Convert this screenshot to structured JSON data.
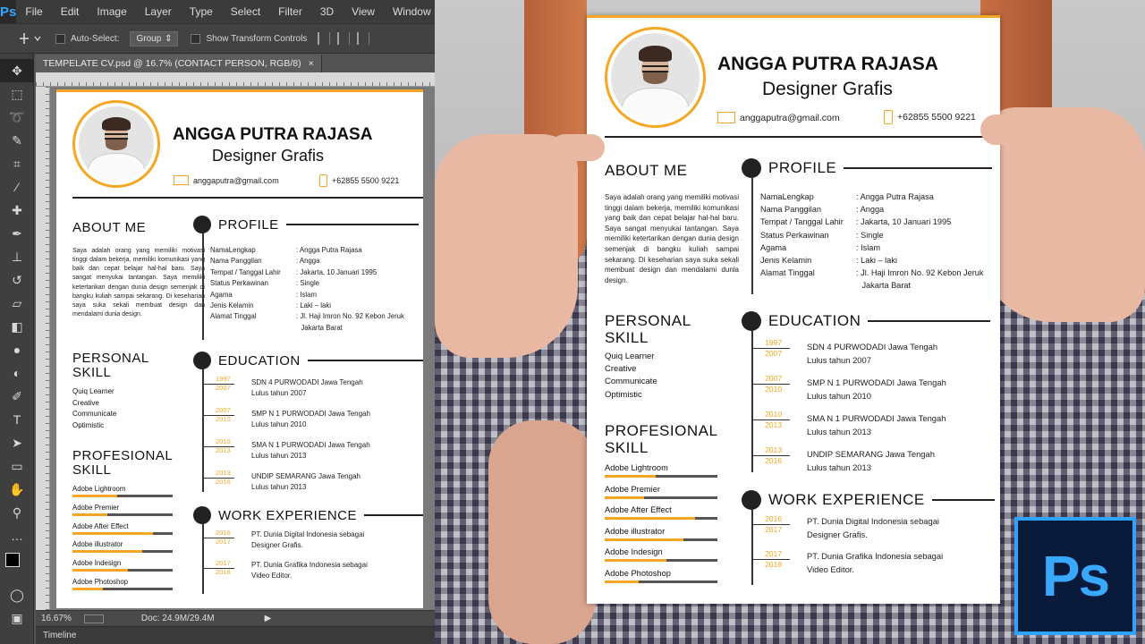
{
  "photoshop": {
    "logo": "Ps",
    "menu": [
      "File",
      "Edit",
      "Image",
      "Layer",
      "Type",
      "Select",
      "Filter",
      "3D",
      "View",
      "Window"
    ],
    "options": {
      "auto_select_label": "Auto-Select:",
      "group_value": "Group",
      "show_transform_label": "Show Transform Controls"
    },
    "document_tab": "TEMPELATE CV.psd @ 16.7% (CONTACT PERSON, RGB/8)",
    "close_glyph": "×",
    "status": {
      "zoom": "16.67%",
      "doc": "Doc: 24.9M/29.4M"
    },
    "timeline_label": "Timeline",
    "tools": [
      "move-icon",
      "marquee-icon",
      "lasso-icon",
      "quick-select-icon",
      "crop-icon",
      "eyedropper-icon",
      "healing-icon",
      "brush-icon",
      "stamp-icon",
      "history-brush-icon",
      "eraser-icon",
      "gradient-icon",
      "blur-icon",
      "dodge-icon",
      "pen-icon",
      "type-icon",
      "path-select-icon",
      "shape-icon",
      "hand-icon",
      "zoom-icon"
    ]
  },
  "cv": {
    "name": "ANGGA PUTRA RAJASA",
    "role": "Designer Grafis",
    "email": "anggaputra@gmail.com",
    "phone": "+62855 5500 9221",
    "about_title": "ABOUT ME",
    "about_text": "Saya adalah orang yang memiliki motivasi tinggi dalam bekerja, memiliki komunikasi yang baik dan cepat belajar hal-hal baru. Saya sangat menyukai tantangan. Saya memiliki ketertarikan dengan dunia design semenjak di bangku kuliah sampai sekarang. Di keseharian saya suka sekali membuat design dan mendalami dunia design.",
    "profile_title": "PROFILE",
    "profile": [
      {
        "label": "NamaLengkap",
        "value": ": Angga Putra Rajasa"
      },
      {
        "label": "Nama Panggilan",
        "value": ": Angga"
      },
      {
        "label": "Tempat / Tanggal Lahir",
        "value": ": Jakarta, 10 Januari 1995"
      },
      {
        "label": "Status Perkawinan",
        "value": ": Single"
      },
      {
        "label": "Agama",
        "value": ": Islam"
      },
      {
        "label": "Jenis Kelamin",
        "value": ": Laki – laki"
      },
      {
        "label": "Alamat Tinggal",
        "value": ": Jl. Haji Imron No. 92 Kebon Jeruk"
      }
    ],
    "address_line2": "Jakarta Barat",
    "personal_title_1": "PERSONAL",
    "personal_title_2": "SKILL",
    "personal_skills": [
      "Quiq Learner",
      "Creative",
      "Communicate",
      "Optimistic"
    ],
    "pro_title_1": "PROFESIONAL",
    "pro_title_2": "SKILL",
    "pro_skills": [
      {
        "name": "Adobe Lightroom",
        "level": 0.45
      },
      {
        "name": "Adobe Premier",
        "level": 0.35
      },
      {
        "name": "Adobe After Effect",
        "level": 0.8
      },
      {
        "name": "Adobe illustrator",
        "level": 0.7
      },
      {
        "name": "Adobe Indesign",
        "level": 0.55
      },
      {
        "name": "Adobe Photoshop",
        "level": 0.3
      }
    ],
    "education_title": "EDUCATION",
    "education": [
      {
        "y1": "1997",
        "y2": "2007",
        "school": "SDN 4 PURWODADI Jawa Tengah",
        "grad": "Lulus tahun 2007"
      },
      {
        "y1": "2007",
        "y2": "2010",
        "school": "SMP N 1 PURWODADI  Jawa Tengah",
        "grad": "Lulus tahun 2010"
      },
      {
        "y1": "2010",
        "y2": "2013",
        "school": "SMA N 1 PURWODADI Jawa Tengah",
        "grad": "Lulus tahun 2013"
      },
      {
        "y1": "2013",
        "y2": "2016",
        "school": "UNDIP SEMARANG Jawa Tengah",
        "grad": "Lulus tahun 2013"
      }
    ],
    "work_title": "WORK EXPERIENCE",
    "work": [
      {
        "y1": "2016",
        "y2": "2017",
        "line1": "PT. Dunia Digital Indonesia sebagai",
        "line2": "Designer Grafis."
      },
      {
        "y1": "2017",
        "y2": "2018",
        "line1": "PT. Dunia Grafika Indonesia sebagai",
        "line2": "Video Editor."
      }
    ]
  },
  "badge": "Ps",
  "colors": {
    "accent": "#f5a623",
    "ps_blue": "#31a8ff",
    "ps_dark": "#0a1a3a"
  }
}
